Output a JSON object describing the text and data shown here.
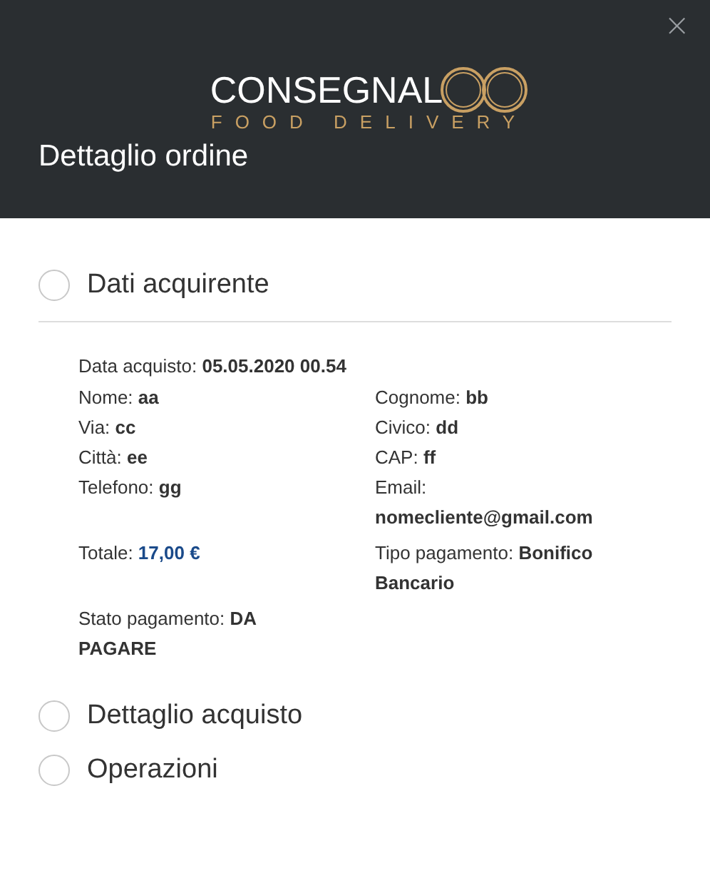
{
  "logo": {
    "wordmark": "CONSEGNAL",
    "tagline": "FOOD DELIVERY"
  },
  "close": "×",
  "title": "Dettaglio ordine",
  "sections": [
    {
      "title": "Dati acquirente",
      "details": {
        "purchase_date": {
          "label": "Data acquisto:",
          "value": "05.05.2020 00.54"
        },
        "fields": [
          {
            "label": "Nome:",
            "value": "aa",
            "kind": "plain"
          },
          {
            "label": "Cognome:",
            "value": "bb",
            "kind": "plain"
          },
          {
            "label": "Via:",
            "value": "cc",
            "kind": "plain"
          },
          {
            "label": "Civico:",
            "value": "dd",
            "kind": "plain"
          },
          {
            "label": "Città:",
            "value": "ee",
            "kind": "plain"
          },
          {
            "label": "CAP:",
            "value": "ff",
            "kind": "plain"
          },
          {
            "label": "Telefono:",
            "value": "gg",
            "kind": "plain"
          },
          {
            "label": "Email:",
            "value": "nomecliente@gmail.com",
            "kind": "plain"
          },
          {
            "label": "Totale:",
            "value": "17,00 €",
            "kind": "amount"
          },
          {
            "label": "Tipo pagamento:",
            "value": "Bonifico Bancario",
            "kind": "plain"
          },
          {
            "label": "Stato pagamento:",
            "value": "DA PAGARE",
            "kind": "plain"
          }
        ]
      }
    },
    {
      "title": "Dettaglio acquisto"
    },
    {
      "title": "Operazioni"
    }
  ]
}
